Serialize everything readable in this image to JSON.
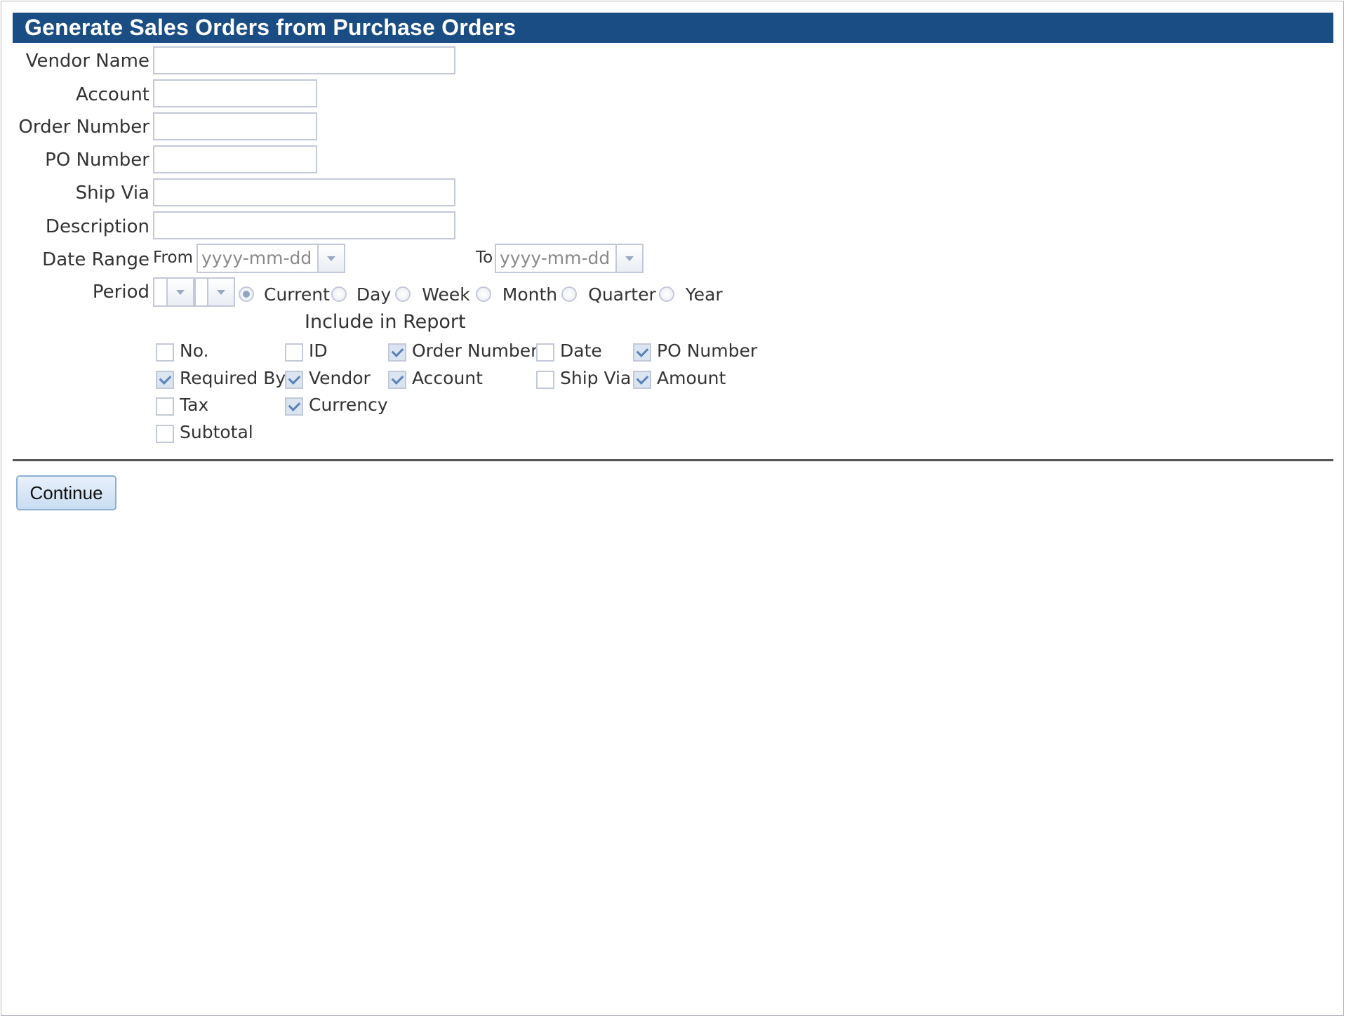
{
  "header": {
    "title": "Generate Sales Orders from Purchase Orders"
  },
  "form": {
    "vendor_name_label": "Vendor Name",
    "account_label": "Account",
    "order_number_label": "Order Number",
    "po_number_label": "PO Number",
    "ship_via_label": "Ship Via",
    "description_label": "Description",
    "date_range_label": "Date Range",
    "from_label": "From",
    "to_label": "To",
    "from_placeholder": "yyyy-mm-dd",
    "to_placeholder": "yyyy-mm-dd",
    "period_label": "Period",
    "period_options": [
      "Current",
      "Day",
      "Week",
      "Month",
      "Quarter",
      "Year"
    ],
    "period_selected": "Current"
  },
  "report": {
    "title": "Include in Report",
    "columns": [
      {
        "label": "No.",
        "checked": false
      },
      {
        "label": "ID",
        "checked": false
      },
      {
        "label": "Order Number",
        "checked": true
      },
      {
        "label": "Date",
        "checked": false
      },
      {
        "label": "PO Number",
        "checked": true
      },
      {
        "label": "Required By",
        "checked": true
      },
      {
        "label": "Vendor",
        "checked": true
      },
      {
        "label": "Account",
        "checked": true
      },
      {
        "label": "Ship Via",
        "checked": false
      },
      {
        "label": "Amount",
        "checked": true
      },
      {
        "label": "Tax",
        "checked": false
      },
      {
        "label": "Currency",
        "checked": true
      },
      {
        "label": "Subtotal",
        "checked": false
      }
    ]
  },
  "actions": {
    "continue_label": "Continue"
  },
  "colors": {
    "header_bg": "#1a4d84",
    "border": "#c3c9d9",
    "button_bg": "#c9dcf2"
  }
}
